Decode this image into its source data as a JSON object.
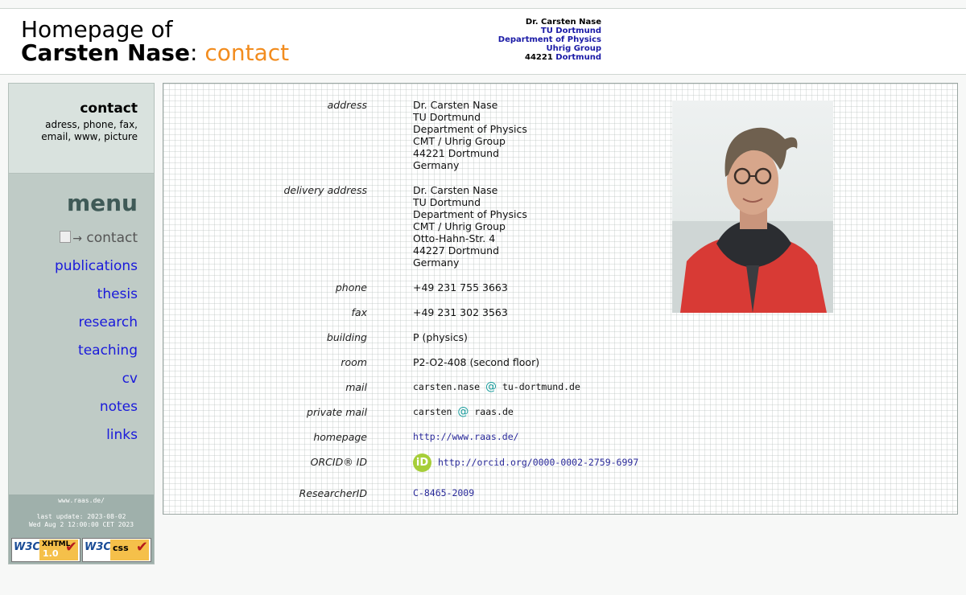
{
  "header": {
    "title_line1": "Homepage of",
    "title_name": "Carsten Nase",
    "title_sep": ":",
    "title_section": "contact",
    "address": {
      "name": "Dr. Carsten Nase",
      "org": "TU Dortmund",
      "dept": "Department of Physics",
      "group": "Uhrig Group",
      "zip": "44221",
      "city": "Dortmund"
    }
  },
  "sidebar": {
    "section_title": "contact",
    "section_desc": "adress, phone, fax, email, www, picture",
    "menu_title": "menu",
    "menu_current_arrow": "→",
    "items": [
      {
        "label": "contact"
      },
      {
        "label": "publications"
      },
      {
        "label": "thesis"
      },
      {
        "label": "research"
      },
      {
        "label": "teaching"
      },
      {
        "label": "cv"
      },
      {
        "label": "notes"
      },
      {
        "label": "links"
      }
    ],
    "footer": {
      "www": "www.raas.de/",
      "last_update": "last update: 2023-08-02",
      "date": "Wed Aug 2 12:00:00 CET 2023",
      "badge_xhtml": {
        "w3c": "W3C",
        "top": "XHTML",
        "bottom": "1.0"
      },
      "badge_css": {
        "w3c": "W3C",
        "top": "css"
      }
    }
  },
  "contact": {
    "address_label": "address",
    "address_lines": [
      "Dr. Carsten Nase",
      "TU Dortmund",
      "Department of Physics",
      "CMT / Uhrig Group",
      "44221 Dortmund",
      "Germany"
    ],
    "delivery_label": "delivery address",
    "delivery_lines": [
      "Dr. Carsten Nase",
      "TU Dortmund",
      "Department of Physics",
      "CMT / Uhrig Group",
      "Otto-Hahn-Str. 4",
      "44227 Dortmund",
      "Germany"
    ],
    "phone_label": "phone",
    "phone": "+49 231 755 3663",
    "fax_label": "fax",
    "fax": "+49 231 302 3563",
    "building_label": "building",
    "building": "P (physics)",
    "room_label": "room",
    "room": "P2-O2-408 (second floor)",
    "mail_label": "mail",
    "mail_user": "carsten.nase",
    "mail_at": "@",
    "mail_domain": "tu-dortmund.de",
    "private_mail_label": "private mail",
    "private_mail_user": "carsten",
    "private_mail_domain": "raas.de",
    "homepage_label": "homepage",
    "homepage": "http://www.raas.de/",
    "orcid_label": "ORCID® ID",
    "orcid_icon": "iD",
    "orcid": "http://orcid.org/0000-0002-2759-6997",
    "researcher_label": "ResearcherID",
    "researcher_id": "C-8465-2009"
  },
  "colors": {
    "accent_orange": "#f28c1e",
    "link_blue": "#1a1adb",
    "orcid_green": "#a6ce39",
    "at_teal": "#199c9c"
  }
}
